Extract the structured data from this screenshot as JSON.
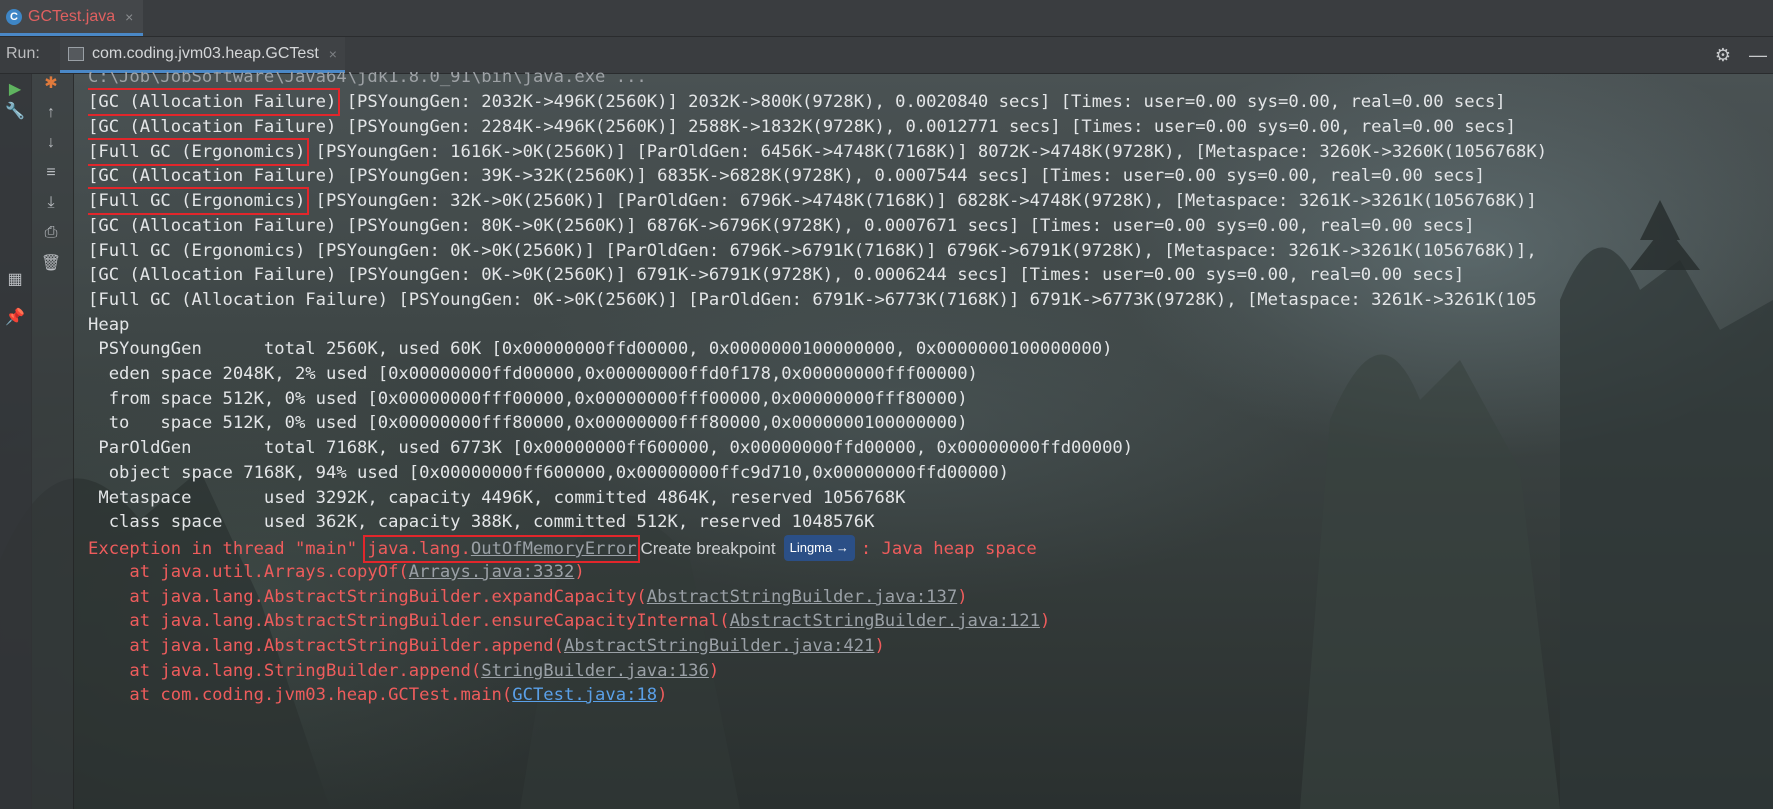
{
  "editor_tab": {
    "name": "GCTest.java",
    "close": "×",
    "icon": "C"
  },
  "run_bar": {
    "label": "Run:",
    "tab_name": "com.coding.jvm03.heap.GCTest",
    "tab_close": "×"
  },
  "console": {
    "command": "C:\\Job\\JobSoftware\\Java64\\jdk1.8.0_91\\bin\\java.exe ...",
    "gc_lines": [
      {
        "head": "[GC (Allocation Failure)",
        "rest": " [PSYoungGen: 2032K->496K(2560K)] 2032K->800K(9728K), 0.0020840 secs] [Times: user=0.00 sys=0.00, real=0.00 secs]"
      },
      {
        "head": "[GC (Allocation Failure)",
        "rest": " [PSYoungGen: 2284K->496K(2560K)] 2588K->1832K(9728K), 0.0012771 secs] [Times: user=0.00 sys=0.00, real=0.00 secs]"
      },
      {
        "head": "[Full GC (Ergonomics)",
        "rest": " [PSYoungGen: 1616K->0K(2560K)] [ParOldGen: 6456K->4748K(7168K)] 8072K->4748K(9728K), [Metaspace: 3260K->3260K(1056768K)"
      },
      {
        "head": "[GC (Allocation Failure)",
        "rest": " [PSYoungGen: 39K->32K(2560K)] 6835K->6828K(9728K), 0.0007544 secs] [Times: user=0.00 sys=0.00, real=0.00 secs]"
      },
      {
        "head": "[Full GC (Ergonomics)",
        "rest": " [PSYoungGen: 32K->0K(2560K)] [ParOldGen: 6796K->4748K(7168K)] 6828K->4748K(9728K), [Metaspace: 3261K->3261K(1056768K)]"
      },
      {
        "head": "[GC (Allocation Failure)",
        "rest": " [PSYoungGen: 80K->0K(2560K)] 6876K->6796K(9728K), 0.0007671 secs] [Times: user=0.00 sys=0.00, real=0.00 secs]"
      },
      {
        "head": "[Full GC (Ergonomics)",
        "rest": " [PSYoungGen: 0K->0K(2560K)] [ParOldGen: 6796K->6791K(7168K)] 6796K->6791K(9728K), [Metaspace: 3261K->3261K(1056768K)],"
      },
      {
        "head": "[GC (Allocation Failure)",
        "rest": " [PSYoungGen: 0K->0K(2560K)] 6791K->6791K(9728K), 0.0006244 secs] [Times: user=0.00 sys=0.00, real=0.00 secs]"
      },
      {
        "head": "[Full GC (Allocation Failure)",
        "rest": " [PSYoungGen: 0K->0K(2560K)] [ParOldGen: 6791K->6773K(7168K)] 6791K->6773K(9728K), [Metaspace: 3261K->3261K(105"
      }
    ],
    "heap_lines": [
      "Heap",
      " PSYoungGen      total 2560K, used 60K [0x00000000ffd00000, 0x0000000100000000, 0x0000000100000000)",
      "  eden space 2048K, 2% used [0x00000000ffd00000,0x00000000ffd0f178,0x00000000fff00000)",
      "  from space 512K, 0% used [0x00000000fff00000,0x00000000fff00000,0x00000000fff80000)",
      "  to   space 512K, 0% used [0x00000000fff80000,0x00000000fff80000,0x0000000100000000)",
      " ParOldGen       total 7168K, used 6773K [0x00000000ff600000, 0x00000000ffd00000, 0x00000000ffd00000)",
      "  object space 7168K, 94% used [0x00000000ff600000,0x00000000ffc9d710,0x00000000ffd00000)",
      " Metaspace       used 3292K, capacity 4496K, committed 4864K, reserved 1056768K",
      "  class space    used 362K, capacity 388K, committed 512K, reserved 1048576K"
    ],
    "exception": {
      "prefix": "Exception in thread \"main\" ",
      "class_pkg": "java.lang.",
      "class_name": "OutOfMemoryError",
      "breakpoint": "Create breakpoint",
      "lingma": "Lingma →",
      "message": ": Java heap space"
    },
    "stack": [
      {
        "at": "    at java.util.Arrays.copyOf(",
        "link": "Arrays.java:3332",
        "end": ")"
      },
      {
        "at": "    at java.lang.AbstractStringBuilder.expandCapacity(",
        "link": "AbstractStringBuilder.java:137",
        "end": ")"
      },
      {
        "at": "    at java.lang.AbstractStringBuilder.ensureCapacityInternal(",
        "link": "AbstractStringBuilder.java:121",
        "end": ")"
      },
      {
        "at": "    at java.lang.AbstractStringBuilder.append(",
        "link": "AbstractStringBuilder.java:421",
        "end": ")"
      },
      {
        "at": "    at java.lang.StringBuilder.append(",
        "link": "StringBuilder.java:136",
        "end": ")"
      },
      {
        "at": "    at com.coding.jvm03.heap.GCTest.main(",
        "link": "GCTest.java:18",
        "end": ")"
      }
    ]
  },
  "colors": {
    "error_text": "#ee5c5c",
    "highlight_box": "#e2262b",
    "tab_accent": "#4a88c7",
    "file_tab_name": "#e06060"
  }
}
